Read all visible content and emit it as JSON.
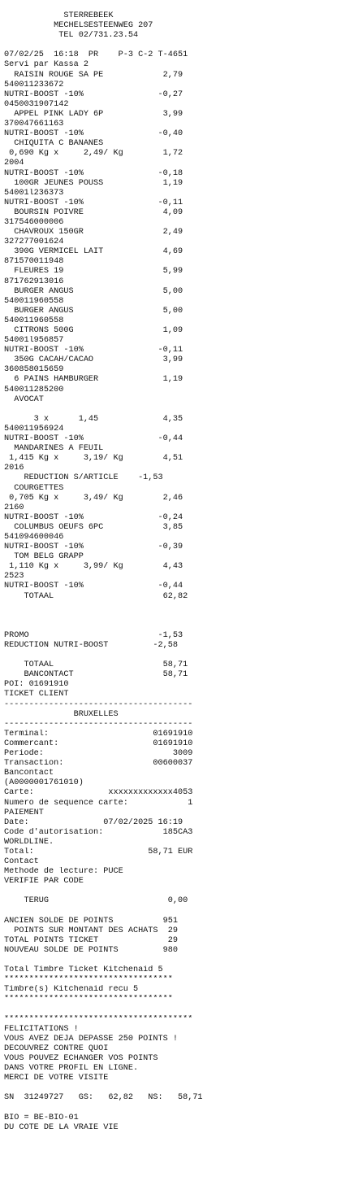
{
  "receipt": {
    "lines": [
      "            STERREBEEK",
      "          MECHELSESTEENWEG 207",
      "           TEL 02/731.23.54",
      "",
      "07/02/25  16:18  PR    P-3 C-2 T-4651",
      "Servi par Kassa 2",
      "  RAISIN ROUGE SA PE            2,79",
      "540011233672",
      "NUTRI-BOOST -10%               -0,27",
      "0450031907142",
      "  APPEL PINK LADY 6P            3,99",
      "370047661163",
      "NUTRI-BOOST -10%               -0,40",
      "  CHIQUITA C BANANES",
      " 0,690 Kg x     2,49/ Kg        1,72",
      "2004",
      "NUTRI-BOOST -10%               -0,18",
      "  100GR JEUNES POUSS            1,19",
      "54001l236373",
      "NUTRI-BOOST -10%               -0,11",
      "  BOURSIN POIVRE                4,09",
      "317546000006",
      "  CHAVROUX 150GR                2,49",
      "327277001624",
      "  390G VERMICEL LAIT            4,69",
      "871570011948",
      "  FLEURES 19                    5,99",
      "871762913016",
      "  BURGER ANGUS                  5,00",
      "540011960558",
      "  BURGER ANGUS                  5,00",
      "540011960558",
      "  CITRONS 500G                  1,09",
      "54001l956857",
      "NUTRI-BOOST -10%               -0,11",
      "  350G CACAH/CACAO              3,99",
      "360858015659",
      "  6 PAINS HAMBURGER             1,19",
      "540011285200",
      "  AVOCAT",
      "",
      "      3 x      1,45             4,35",
      "540011956924",
      "NUTRI-BOOST -10%               -0,44",
      "  MANDARINES A FEUIL",
      " 1,415 Kg x     3,19/ Kg        4,51",
      "2016",
      "    REDUCTION S/ARTICLE    -1,53",
      "  COURGETTES",
      " 0,705 Kg x     3,49/ Kg        2,46",
      "2160",
      "NUTRI-BOOST -10%               -0,24",
      "  COLUMBUS OEUFS 6PC            3,85",
      "541094600046",
      "NUTRI-BOOST -10%               -0,39",
      "  TOM BELG GRAPP",
      " 1,110 Kg x     3,99/ Kg        4,43",
      "2523",
      "NUTRI-BOOST -10%               -0,44",
      "    TOTAAL                      62,82",
      "",
      "",
      "",
      "PROMO                          -1,53",
      "REDUCTION NUTRI-BOOST         -2,58",
      "",
      "    TOTAAL                      58,71",
      "    BANCONTACT                  58,71",
      "POI: 01691910",
      "TICKET CLIENT",
      "--------------------------------------",
      "              BRUXELLES",
      "--------------------------------------",
      "Terminal:                     01691910",
      "Commercant:                   01691910",
      "Periode:                          3009",
      "Transaction:                  00600037",
      "Bancontact",
      "(A0000001761010)",
      "Carte:               xxxxxxxxxxxxx4053",
      "Numero de sequence carte:            1",
      "PAIEMENT",
      "Date:               07/02/2025 16:19",
      "Code d'autorisation:            185CA3",
      "WORLDLINE.",
      "Total:                       58,71 EUR",
      "Contact",
      "Methode de lecture: PUCE",
      "VERIFIE PAR CODE",
      "",
      "    TERUG                        0,00",
      "",
      "ANCIEN SOLDE DE POINTS          951",
      "  POINTS SUR MONTANT DES ACHATS  29",
      "TOTAL POINTS TICKET              29",
      "NOUVEAU SOLDE DE POINTS         980",
      "",
      "Total Timbre Ticket Kitchenaid 5",
      "**********************************",
      "Timbre(s) Kitchenaid recu 5",
      "**********************************",
      "",
      "**************************************",
      "FELICITATIONS !",
      "VOUS AVEZ DEJA DEPASSE 250 POINTS !",
      "DECOUVREZ CONTRE QUOI",
      "VOUS POUVEZ ECHANGER VOS POINTS",
      "DANS VOTRE PROFIL EN LIGNE.",
      "MERCI DE VOTRE VISITE",
      "",
      "SN  31249727   GS:   62,82   NS:   58,71",
      "",
      "BIO = BE-BIO-01",
      "DU COTE DE LA VRAIE VIE"
    ]
  }
}
